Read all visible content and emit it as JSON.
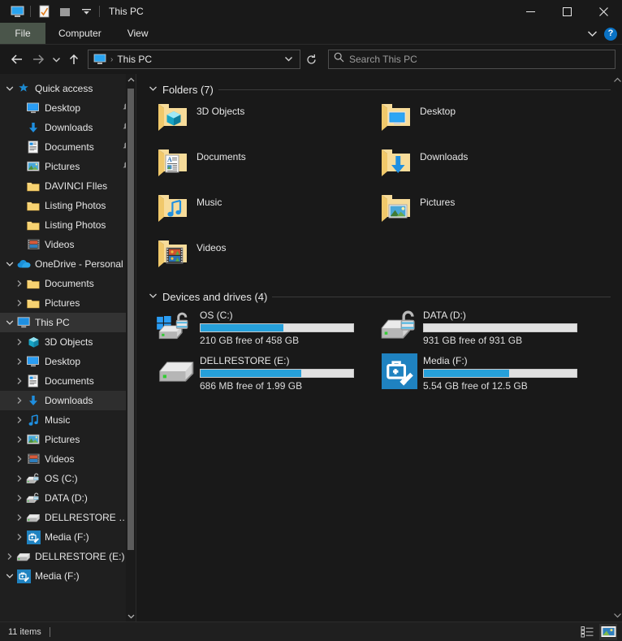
{
  "window": {
    "title": "This PC",
    "quick_access_toolbar": [
      {
        "name": "this-pc-icon",
        "label": "This PC"
      },
      {
        "name": "properties-icon",
        "label": "Properties"
      },
      {
        "name": "new-folder-icon",
        "label": "New folder"
      },
      {
        "name": "customize-chevron-icon",
        "label": "Customize Quick Access Toolbar"
      }
    ],
    "controls": {
      "minimize": "—",
      "maximize": "□",
      "close": "✕"
    }
  },
  "ribbon": {
    "tabs": [
      {
        "label": "File",
        "active": true
      },
      {
        "label": "Computer",
        "active": false
      },
      {
        "label": "View",
        "active": false
      }
    ],
    "expand_label": "⌄",
    "help_label": "?"
  },
  "navigation": {
    "back_label": "Back",
    "forward_label": "Forward",
    "recent_label": "Recent locations",
    "up_label": "Up",
    "address_text": "This PC",
    "address_icon": "this-pc-icon",
    "address_chevron": "⌄",
    "refresh_label": "↻"
  },
  "search": {
    "placeholder": "Search This PC",
    "icon": "search-icon"
  },
  "sidebar": {
    "sections": [
      {
        "id": "quick-access",
        "label": "Quick access",
        "icon": "star-icon",
        "expander": "⌄",
        "indent": 0,
        "items": [
          {
            "label": "Desktop",
            "icon": "desktop-icon",
            "pinned": true,
            "indent": 1
          },
          {
            "label": "Downloads",
            "icon": "downloads-icon",
            "pinned": true,
            "indent": 1
          },
          {
            "label": "Documents",
            "icon": "documents-icon",
            "pinned": true,
            "indent": 1
          },
          {
            "label": "Pictures",
            "icon": "pictures-icon",
            "pinned": true,
            "indent": 1
          },
          {
            "label": "DAVINCI FIles",
            "icon": "folder-icon",
            "pinned": false,
            "indent": 1
          },
          {
            "label": "Listing Photos",
            "icon": "folder-icon",
            "pinned": false,
            "indent": 1
          },
          {
            "label": "Listing Photos",
            "icon": "folder-icon",
            "pinned": false,
            "indent": 1
          },
          {
            "label": "Videos",
            "icon": "videos-icon",
            "pinned": false,
            "indent": 1
          }
        ]
      },
      {
        "id": "onedrive",
        "label": "OneDrive - Personal",
        "icon": "onedrive-icon",
        "expander": "⌄",
        "indent": 0,
        "items": [
          {
            "label": "Documents",
            "icon": "folder-icon",
            "expander": "›",
            "indent": 1
          },
          {
            "label": "Pictures",
            "icon": "folder-icon",
            "expander": "›",
            "indent": 1
          }
        ]
      },
      {
        "id": "this-pc",
        "label": "This PC",
        "icon": "this-pc-icon",
        "expander": "⌄",
        "indent": 0,
        "selected": true,
        "items": [
          {
            "label": "3D Objects",
            "icon": "3d-objects-icon",
            "expander": "›",
            "indent": 1
          },
          {
            "label": "Desktop",
            "icon": "desktop-icon",
            "expander": "›",
            "indent": 1
          },
          {
            "label": "Documents",
            "icon": "documents-icon",
            "expander": "›",
            "indent": 1
          },
          {
            "label": "Downloads",
            "icon": "downloads-icon",
            "expander": "›",
            "indent": 1,
            "highlighted": true
          },
          {
            "label": "Music",
            "icon": "music-icon",
            "expander": "›",
            "indent": 1
          },
          {
            "label": "Pictures",
            "icon": "pictures-icon",
            "expander": "›",
            "indent": 1
          },
          {
            "label": "Videos",
            "icon": "videos-icon",
            "expander": "›",
            "indent": 1
          },
          {
            "label": "OS (C:)",
            "icon": "drive-bitlocker-icon",
            "expander": "›",
            "indent": 1
          },
          {
            "label": "DATA (D:)",
            "icon": "drive-bitlocker-icon",
            "expander": "›",
            "indent": 1
          },
          {
            "label": "DELLRESTORE (E:)",
            "icon": "drive-icon",
            "expander": "›",
            "indent": 1
          },
          {
            "label": "Media (F:)",
            "icon": "recovery-drive-icon",
            "expander": "›",
            "indent": 1
          }
        ]
      },
      {
        "id": "dellrestore-root",
        "label": "DELLRESTORE (E:)",
        "icon": "drive-icon",
        "expander": "›",
        "indent": 0,
        "items": []
      },
      {
        "id": "media-root",
        "label": "Media (F:)",
        "icon": "recovery-drive-icon",
        "expander": "⌄",
        "indent": 0,
        "items": []
      }
    ],
    "scroll_up": "⌃",
    "scroll_down": "⌄"
  },
  "main": {
    "groups": [
      {
        "id": "folders",
        "title": "Folders (7)",
        "chevron": "⌄",
        "items": [
          {
            "label": "3D Objects",
            "icon": "folder-3d-objects-icon"
          },
          {
            "label": "Desktop",
            "icon": "folder-desktop-icon"
          },
          {
            "label": "Documents",
            "icon": "folder-documents-icon"
          },
          {
            "label": "Downloads",
            "icon": "folder-downloads-icon"
          },
          {
            "label": "Music",
            "icon": "folder-music-icon"
          },
          {
            "label": "Pictures",
            "icon": "folder-pictures-icon"
          },
          {
            "label": "Videos",
            "icon": "folder-videos-icon"
          }
        ]
      },
      {
        "id": "devices",
        "title": "Devices and drives (4)",
        "chevron": "⌄",
        "drives": [
          {
            "label": "OS (C:)",
            "icon": "drive-windows-bitlocker-icon",
            "free_text": "210 GB free of 458 GB",
            "used_percent": 54
          },
          {
            "label": "DATA (D:)",
            "icon": "drive-bitlocker-icon",
            "free_text": "931 GB free of 931 GB",
            "used_percent": 0
          },
          {
            "label": "DELLRESTORE (E:)",
            "icon": "drive-icon",
            "free_text": "686 MB free of 1.99 GB",
            "used_percent": 66
          },
          {
            "label": "Media (F:)",
            "icon": "recovery-drive-icon",
            "free_text": "5.54 GB free of 12.5 GB",
            "used_percent": 56
          }
        ]
      }
    ],
    "scroll_up": "⌃",
    "scroll_down": "⌄"
  },
  "statusbar": {
    "item_count": "11 items",
    "views": [
      {
        "name": "details-view-button",
        "label": "Details view",
        "active": false
      },
      {
        "name": "large-icons-view-button",
        "label": "Large icons view",
        "active": true
      }
    ]
  },
  "colors": {
    "accent": "#26a0da",
    "window_bg": "#191919",
    "sidebar_bg": "#1f1f1f",
    "selection": "#333333",
    "file_tab": "#4a554a",
    "help_blue": "#0a72c4",
    "folder_yellow": "#f5d07a"
  }
}
